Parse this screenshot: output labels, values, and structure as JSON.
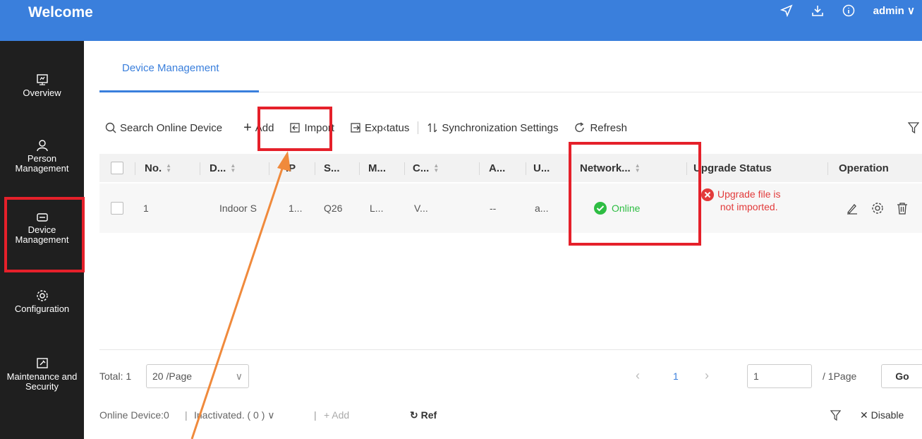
{
  "header": {
    "title": "Welcome",
    "user": "admin"
  },
  "sidebar": {
    "items": [
      {
        "label": "Overview",
        "icon": "overview-icon"
      },
      {
        "label": "Person Management",
        "icon": "person-icon"
      },
      {
        "label": "Device Management",
        "icon": "device-icon"
      },
      {
        "label": "Configuration",
        "icon": "gear-icon"
      },
      {
        "label": "Maintenance and Security",
        "icon": "maintenance-icon"
      }
    ]
  },
  "tabs": {
    "active": "Device Management"
  },
  "toolbar": {
    "search": "Search Online Device",
    "add": "Add",
    "import": "Import",
    "export": "Exp‹tatus",
    "sync": "Synchronization Settings",
    "refresh": "Refresh"
  },
  "table": {
    "headers": [
      "No.",
      "D...",
      "IP",
      "S...",
      "M...",
      "C...",
      "A...",
      "U...",
      "Network...",
      "Upgrade Status",
      "Operation"
    ],
    "row": {
      "no": "1",
      "d": "Indoor S",
      "ip": "1...",
      "s": "Q26",
      "m": "L...",
      "c": "V...",
      "a": "--",
      "u": "a...",
      "network": "Online",
      "upgrade_line1": "Upgrade file is",
      "upgrade_line2": "not imported."
    }
  },
  "pager": {
    "total": "Total: 1",
    "page_size": "20 /Page",
    "current_page": "1",
    "jump_value": "1",
    "pages": "/ 1Page",
    "go": "Go"
  },
  "bottom": {
    "online": "Online Device:0",
    "inactivated": "Inactivated. ( 0 )",
    "add": "Add",
    "refresh": "Ref",
    "disable": "Disable"
  },
  "colors": {
    "accent": "#3a7fdc",
    "highlight": "#e5202a",
    "online": "#2ebd43",
    "error": "#e23b3b",
    "arrow": "#f08a3c"
  }
}
